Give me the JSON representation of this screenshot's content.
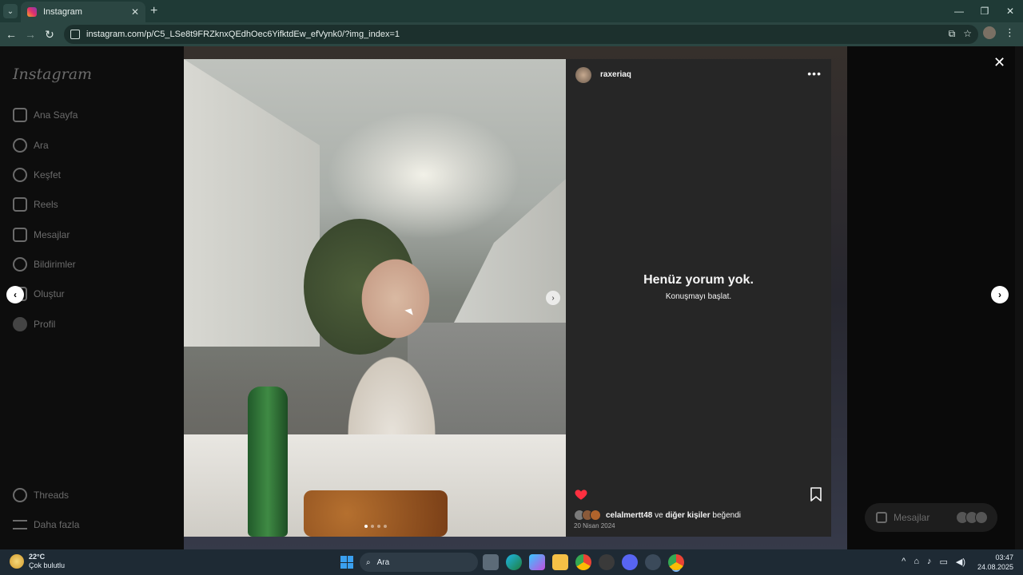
{
  "browser": {
    "tab_title": "Instagram",
    "url": "instagram.com/p/C5_LSe8t9FRZknxQEdhOec6YifktdEw_efVynk0/?img_index=1"
  },
  "sidebar": {
    "logo": "Instagram",
    "items": [
      {
        "label": "Ana Sayfa",
        "icon": "home-icon"
      },
      {
        "label": "Ara",
        "icon": "search-icon"
      },
      {
        "label": "Keşfet",
        "icon": "explore-icon"
      },
      {
        "label": "Reels",
        "icon": "reels-icon"
      },
      {
        "label": "Mesajlar",
        "icon": "messages-icon"
      },
      {
        "label": "Bildirimler",
        "icon": "heart-icon"
      },
      {
        "label": "Oluştur",
        "icon": "create-icon"
      },
      {
        "label": "Profil",
        "icon": "profile-avatar"
      }
    ],
    "bottom_items": [
      {
        "label": "Threads",
        "icon": "threads-icon"
      },
      {
        "label": "Daha fazla",
        "icon": "menu-icon"
      }
    ]
  },
  "post": {
    "author": "raxeriaq",
    "empty_title": "Henüz yorum yok.",
    "empty_subtitle": "Konuşmayı başlat.",
    "likes_user": "celalmertt48",
    "likes_middle": " ve ",
    "likes_others": "diğer kişiler",
    "likes_suffix": " beğendi",
    "date": "20 Nisan 2024",
    "image_count": 4,
    "current_image": 1,
    "liked": true,
    "heart_color": "#ff3040"
  },
  "messages_pill": {
    "label": "Mesajlar"
  },
  "taskbar": {
    "temperature": "22°C",
    "weather": "Çok bulutlu",
    "search_placeholder": "Ara",
    "time": "03:47",
    "date": "24.08.2025"
  },
  "colors": {
    "panel_bg": "#262626",
    "browser_frame": "#1f3a36",
    "taskbar": "#1e2a34"
  }
}
